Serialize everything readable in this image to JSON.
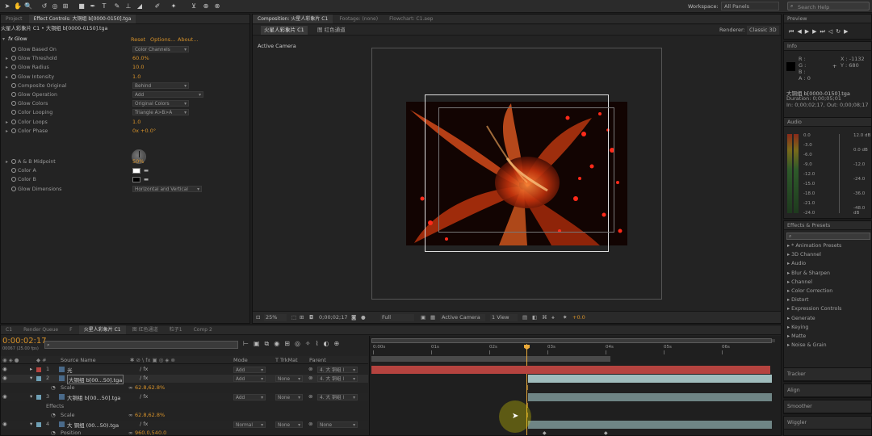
{
  "toolbar": {
    "workspace_label": "Workspace:",
    "workspace_value": "All Panels",
    "search_placeholder": "Search Help"
  },
  "effect_controls": {
    "tabs": [
      "Project",
      "Effect Controls: 大铜组 b[0000-0150].tga",
      "Flowchart: C1.aep"
    ],
    "breadcrumb": "火星人彩象片 C1 • 大铜组 b[0000-0150].tga",
    "effect_name": "Glow",
    "reset": "Reset",
    "options": "Options...",
    "about": "About...",
    "properties": [
      {
        "label": "Glow Based On",
        "value": "Color Channels",
        "kind": "drop"
      },
      {
        "label": "Glow Threshold",
        "value": "60.0%",
        "kind": "val"
      },
      {
        "label": "Glow Radius",
        "value": "10.0",
        "kind": "val"
      },
      {
        "label": "Glow Intensity",
        "value": "1.0",
        "kind": "val"
      },
      {
        "label": "Composite Original",
        "value": "Behind",
        "kind": "drop"
      },
      {
        "label": "Glow Operation",
        "value": "Add",
        "kind": "drop"
      },
      {
        "label": "Glow Colors",
        "value": "Original Colors",
        "kind": "drop"
      },
      {
        "label": "Color Looping",
        "value": "Triangle A>B>A",
        "kind": "drop"
      },
      {
        "label": "Color Loops",
        "value": "1.0",
        "kind": "val"
      },
      {
        "label": "Color Phase",
        "value": "0x +0.0°",
        "kind": "val"
      }
    ],
    "properties2": [
      {
        "label": "A & B Midpoint",
        "value": "50%",
        "kind": "val"
      },
      {
        "label": "Color A",
        "value": "",
        "kind": "color-white"
      },
      {
        "label": "Color B",
        "value": "",
        "kind": "color-black"
      },
      {
        "label": "Glow Dimensions",
        "value": "Horizontal and Vertical",
        "kind": "drop"
      }
    ]
  },
  "composition": {
    "tabs": [
      "Composition: 火星人彩象片 C1",
      "Footage: (none)",
      "Flowchart: C1.aep"
    ],
    "subtabs": [
      "火星人彩象片 C1",
      "图 红色通道"
    ],
    "renderer_label": "Renderer:",
    "renderer_value": "Classic 3D",
    "camera_label": "Active Camera",
    "footer": {
      "zoom": "25%",
      "timecode": "0;00;02;17",
      "resolution": "Full",
      "camera": "Active Camera",
      "views": "1 View",
      "exposure": "+0.0"
    }
  },
  "preview": {
    "title": "Preview"
  },
  "info": {
    "title": "Info",
    "r": "R :",
    "g": "G :",
    "b": "B :",
    "a": "A : 0",
    "x": "X : -1132",
    "y": "Y : 680",
    "file": "大铜组 b[0000-0150].tga",
    "duration": "Duration: 0;00;05;01",
    "inout": "In: 0;00;02;17, Out: 0;00;08;17"
  },
  "audio": {
    "title": "Audio",
    "left_scale": [
      "0.0",
      "-3.0",
      "-6.0",
      "-9.0",
      "-12.0",
      "-15.0",
      "-18.0",
      "-21.0",
      "-24.0"
    ],
    "right_scale": [
      "12.0 dB",
      "0.0 dB",
      "-12.0",
      "-24.0",
      "-36.0",
      "-48.0 dB"
    ]
  },
  "effects_presets": {
    "title": "Effects & Presets",
    "search_placeholder": "",
    "items": [
      "* Animation Presets",
      "3D Channel",
      "Audio",
      "Blur & Sharpen",
      "Channel",
      "Color Correction",
      "Distort",
      "Expression Controls",
      "Generate",
      "Keying",
      "Matte",
      "Noise & Grain"
    ]
  },
  "side_panels": [
    "Tracker",
    "Align",
    "Smoother",
    "Wiggler"
  ],
  "timeline": {
    "tabs": [
      "C1",
      "Render Queue",
      "F",
      "火星人彩象片 C1",
      "图 红色通道",
      "粒子1",
      "Comp 2"
    ],
    "timecode": "0:00:02:17",
    "frames": "00067 (25.00 fps)",
    "search_placeholder": "",
    "columns": {
      "source": "Source Name",
      "mode": "Mode",
      "trkmat": "T TrkMat",
      "parent": "Parent"
    },
    "ruler": [
      "0:00s",
      "01s",
      "02s",
      "03s",
      "04s",
      "05s",
      "06s"
    ],
    "layers": [
      {
        "num": "1",
        "name": "光",
        "mode": "Add",
        "trkmat": "",
        "parent": "4. 大 铜组 l"
      },
      {
        "num": "2",
        "name": "大铜组 b[00...50].tga",
        "mode": "Add",
        "trkmat": "None",
        "parent": "4. 大 铜组 l"
      },
      {
        "num": "3",
        "name": "大铜组 b[00...50].tga",
        "mode": "Add",
        "trkmat": "None",
        "parent": "4. 大 铜组 l"
      },
      {
        "num": "4",
        "name": "大 铜组 (00...50).tga",
        "mode": "Normal",
        "trkmat": "None",
        "parent": "None"
      }
    ],
    "sublayers": {
      "scale1_label": "Scale",
      "scale1_value": "62.8,62.8%",
      "effects_label": "Effects",
      "scale2_label": "Scale",
      "scale2_value": "62.8,62.8%",
      "position_label": "Position",
      "position_value": "960.0,540.0"
    }
  },
  "colors": {
    "accent": "#d7922a",
    "bg": "#232323",
    "layer_red": "#b5433f",
    "layer_teal": "#9fbcbc"
  }
}
